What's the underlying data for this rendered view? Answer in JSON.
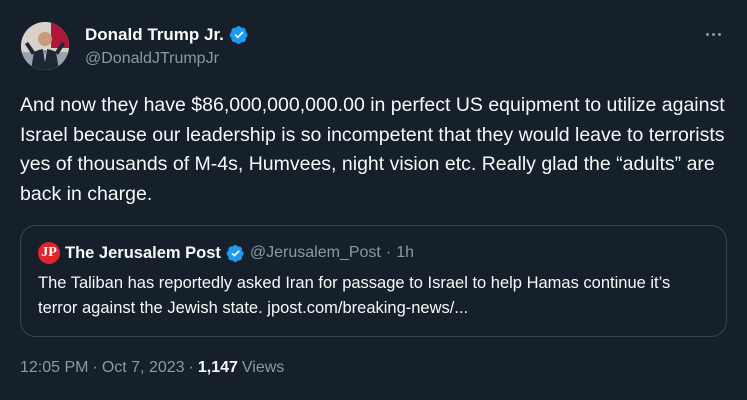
{
  "author": {
    "name": "Donald Trump Jr.",
    "handle": "@DonaldJTrumpJr"
  },
  "tweet": {
    "text": "And now they have $86,000,000,000.00 in perfect US equipment to utilize against Israel because our leadership is so incompetent that they would leave to terrorists yes of thousands of M-4s, Humvees, night vision etc. Really glad the “adults” are back in charge."
  },
  "quote": {
    "logo_text": "JP",
    "name": "The Jerusalem Post",
    "handle": "@Jerusalem_Post",
    "separator": "·",
    "time": "1h",
    "text": "The Taliban has reportedly asked Iran for passage to Israel to help Hamas continue it’s terror against the Jewish state. jpost.com/breaking-news/..."
  },
  "footer": {
    "time": "12:05 PM",
    "dot1": "·",
    "date": "Oct 7, 2023",
    "dot2": "·",
    "views_count": "1,147",
    "views_label": "Views"
  },
  "icons": {
    "verified": "verified-badge-icon",
    "more": "more-options-icon"
  },
  "colors": {
    "background": "#15202b",
    "text": "#f7f9f9",
    "secondary": "#8b98a5",
    "border": "#38444d",
    "verified": "#1d9bf0",
    "jpost_logo": "#e0262c"
  }
}
